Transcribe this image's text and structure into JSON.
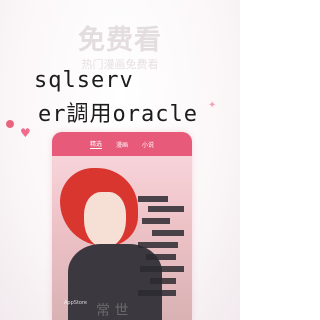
{
  "background": {
    "headline": "免费看",
    "subline": "热门漫画免费看"
  },
  "overlay": {
    "line1": "sqlserv",
    "line2": "er調用oracle"
  },
  "phone": {
    "tabs": [
      "精选",
      "漫画",
      "小说"
    ],
    "status": "AppStore",
    "caption": "常 世"
  },
  "colors": {
    "accent": "#e85a7a",
    "pink": "#f3b9c4"
  }
}
